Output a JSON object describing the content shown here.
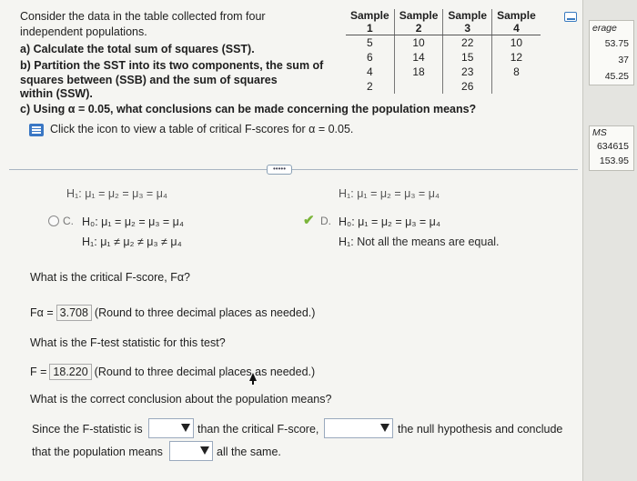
{
  "question": {
    "line1": "Consider the data in the table collected from four",
    "line2": "independent populations.",
    "a": "a) Calculate the total sum of squares (SST).",
    "b1": "b) Partition the SST into its two components, the sum of",
    "b2": "squares between (SSB) and the sum of squares",
    "b3": "within (SSW).",
    "c": "c) Using α = 0.05, what conclusions can be made concerning the population means?",
    "click_text": "Click the icon to view a table of critical F-scores for α = 0.05."
  },
  "table": {
    "header_top": [
      "Sample",
      "Sample",
      "Sample",
      "Sample"
    ],
    "header_num": [
      "1",
      "2",
      "3",
      "4"
    ],
    "rows": [
      [
        "5",
        "10",
        "22",
        "10"
      ],
      [
        "6",
        "14",
        "15",
        "12"
      ],
      [
        "4",
        "18",
        "23",
        "8"
      ],
      [
        "2",
        "",
        "26",
        ""
      ]
    ]
  },
  "more_button": "•••••",
  "hyp": {
    "top_left": "H₁: μ₁ = μ₂ = μ₃ = μ₄",
    "top_right": "H₁: μ₁ = μ₂ = μ₃ = μ₄",
    "c_label": "C.",
    "c_h0": "H₀: μ₁ = μ₂ = μ₃ = μ₄",
    "c_h1": "H₁: μ₁ ≠ μ₂ ≠ μ₃ ≠ μ₄",
    "d_label": "D.",
    "d_h0": "H₀: μ₁ = μ₂ = μ₃ = μ₄",
    "d_h1": "H₁: Not all the means are equal."
  },
  "crit": {
    "question": "What is the critical F-score, Fα?",
    "label": "Fα =",
    "value": "3.708",
    "note": "(Round to three decimal places as needed.)"
  },
  "ftest": {
    "question": "What is the F-test statistic for this test?",
    "label": "F =",
    "value": "18.220",
    "note": "(Round to three decimal places as needed.)"
  },
  "conclusion": {
    "question": "What is the correct conclusion about the population means?",
    "s1": "Since the F-statistic is",
    "s2": "than the critical F-score,",
    "s3": "the null hypothesis and conclude",
    "s4": "that the population means",
    "s5": "all the same."
  },
  "side": {
    "header": "erage",
    "values": [
      "53.75",
      "37",
      "45.25"
    ],
    "ms_header": "MS",
    "ms_values": [
      "634615",
      "153.95"
    ]
  }
}
